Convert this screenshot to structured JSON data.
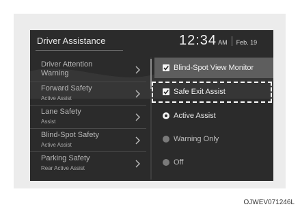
{
  "header": {
    "title": "Driver Assistance",
    "time": "12:34",
    "ampm": "AM",
    "date": "Feb. 19"
  },
  "menu": {
    "items": [
      {
        "title": "Driver Attention",
        "subtitle": "Warning"
      },
      {
        "title": "Forward Safety",
        "subtitle": "Active Assist"
      },
      {
        "title": "Lane Safety",
        "subtitle": "Assist"
      },
      {
        "title": "Blind-Spot Safety",
        "subtitle": "Active Assist"
      },
      {
        "title": "Parking Safety",
        "subtitle": "Rear Active Assist"
      }
    ]
  },
  "options": {
    "checkboxes": [
      {
        "label": "Blind-Spot View Monitor",
        "checked": true
      },
      {
        "label": "Safe Exit Assist",
        "checked": true
      }
    ],
    "radios": [
      {
        "label": "Active Assist",
        "selected": true
      },
      {
        "label": "Warning Only",
        "selected": false
      },
      {
        "label": "Off",
        "selected": false
      }
    ]
  },
  "caption": "OJWEV071246L",
  "colors": {
    "screen_bg": "#2b2b2b",
    "highlight_bg": "#5e5e5e",
    "focus_border": "#ffffff"
  }
}
